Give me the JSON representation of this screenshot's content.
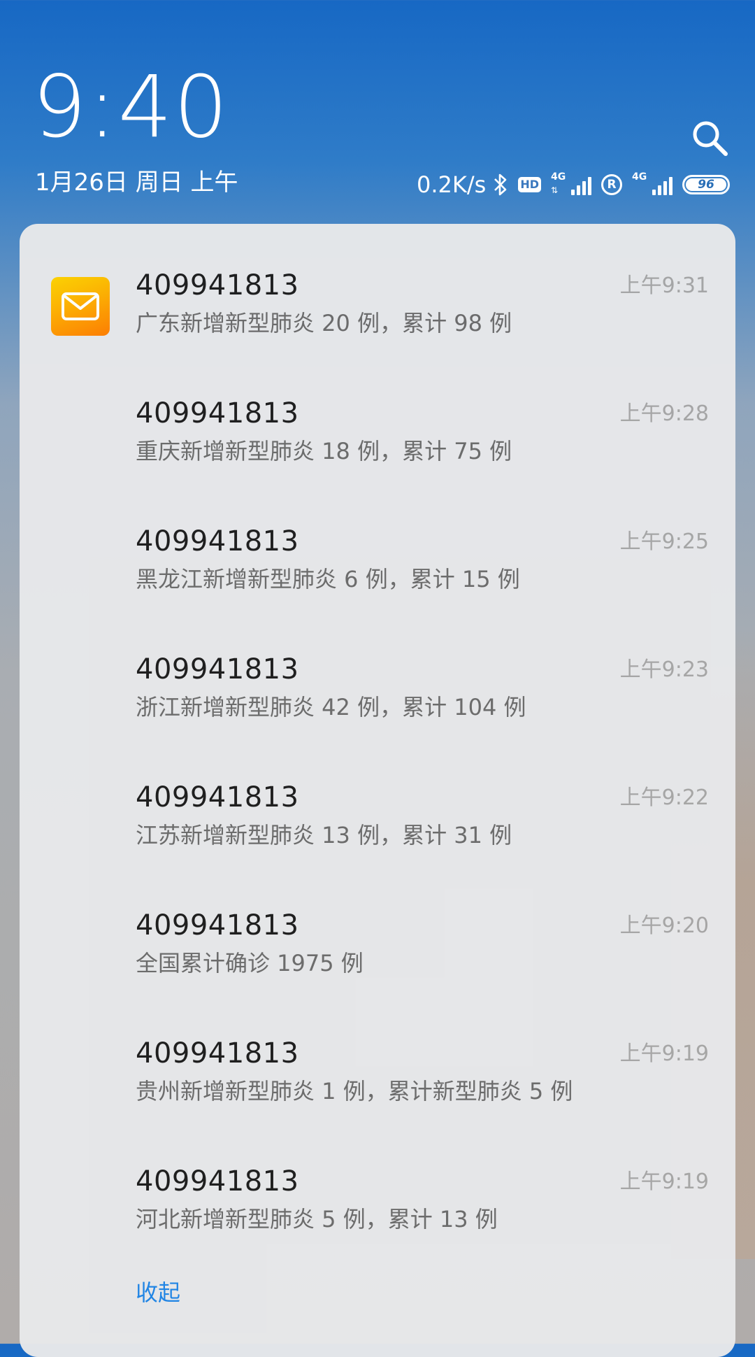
{
  "lockscreen": {
    "time": "9:40",
    "date": "1月26日 周日 上午",
    "search_icon": "search-icon"
  },
  "status_bar": {
    "net_speed": "0.2K/s",
    "bluetooth_icon": "bluetooth-icon",
    "hd_label": "HD",
    "sim1_type": "4G",
    "sim2_type": "4G",
    "roaming_label": "R",
    "battery_level": "96"
  },
  "notifications": {
    "app_icon": "mail-envelope-icon",
    "accent_color": "#1f85e6",
    "items": [
      {
        "sender": "409941813",
        "body": "广东新增新型肺炎 20 例，累计 98 例",
        "time": "上午9:31"
      },
      {
        "sender": "409941813",
        "body": "重庆新增新型肺炎 18 例，累计 75 例",
        "time": "上午9:28"
      },
      {
        "sender": "409941813",
        "body": "黑龙江新增新型肺炎 6 例，累计 15 例",
        "time": "上午9:25"
      },
      {
        "sender": "409941813",
        "body": "浙江新增新型肺炎 42 例，累计 104 例",
        "time": "上午9:23"
      },
      {
        "sender": "409941813",
        "body": "江苏新增新型肺炎 13 例，累计 31 例",
        "time": "上午9:22"
      },
      {
        "sender": "409941813",
        "body": "全国累计确诊 1975 例",
        "time": "上午9:20"
      },
      {
        "sender": "409941813",
        "body": "贵州新增新型肺炎 1 例，累计新型肺炎 5 例",
        "time": "上午9:19"
      },
      {
        "sender": "409941813",
        "body": "河北新增新型肺炎 5 例，累计 13 例",
        "time": "上午9:19"
      }
    ],
    "collapse_label": "收起"
  }
}
